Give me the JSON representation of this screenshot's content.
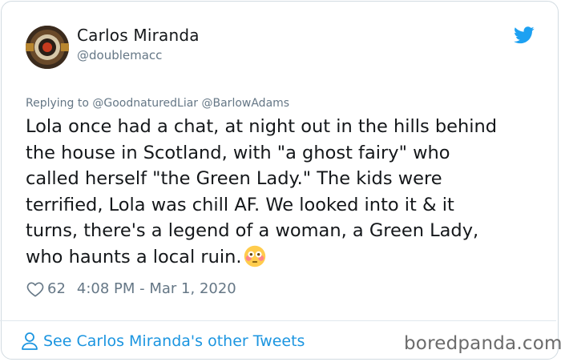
{
  "tweet": {
    "author_name": "Carlos Miranda",
    "author_handle": "@doublemacc",
    "reply_prefix": "Replying to",
    "reply_to": [
      "@GoodnaturedLiar",
      "@BarlowAdams"
    ],
    "body_lines": [
      "Lola once had a chat, at night out in the hills behind",
      "the house in Scotland, with \"a ghost fairy\" who",
      "called herself \"the Green Lady.\" The kids were",
      "terrified, Lola was chill AF. We looked into it & it",
      "turns, there's a legend of a woman, a Green Lady,",
      "who haunts a local ruin."
    ],
    "likes": "62",
    "timestamp": "4:08 PM - Mar 1, 2020",
    "see_more": "See Carlos Miranda's other Tweets"
  },
  "watermark": "boredpanda.com",
  "icons": {
    "brand": "twitter-bird-icon",
    "like": "heart-outline-icon",
    "profile": "person-icon",
    "emoji": "flushed-face-emoji"
  },
  "colors": {
    "twitter_blue": "#1da1f2",
    "link_blue": "#1b95e0",
    "text_primary": "#14171a",
    "text_secondary": "#657786"
  }
}
